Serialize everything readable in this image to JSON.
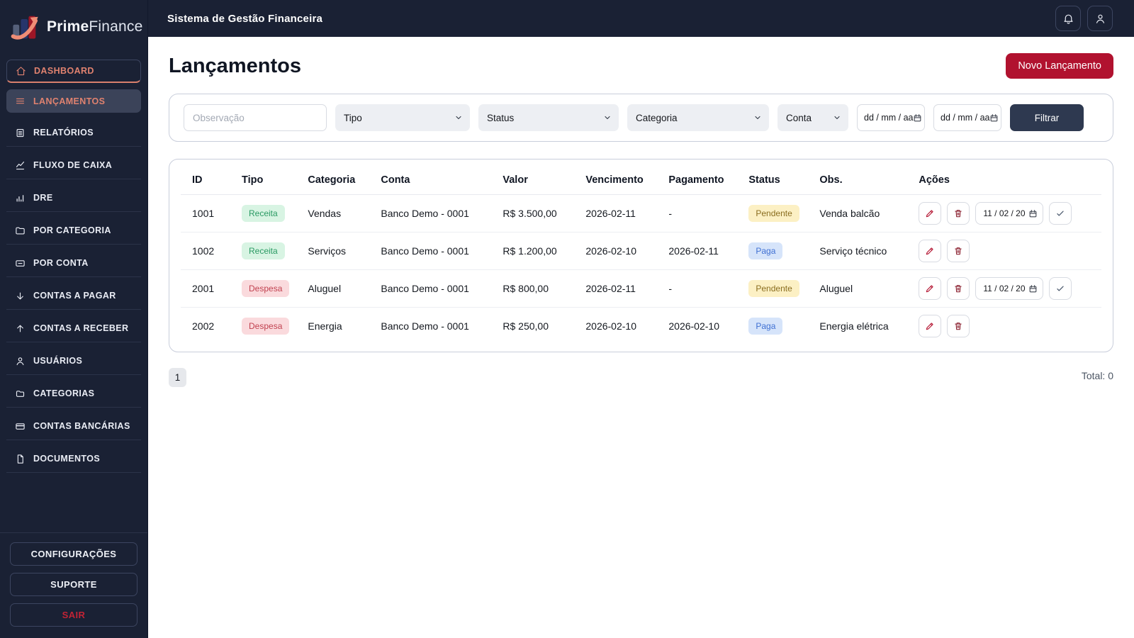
{
  "brand": {
    "name_bold": "Prime",
    "name_light": "Finance"
  },
  "topbar": {
    "title": "Sistema de Gestão Financeira"
  },
  "sidebar": {
    "items": [
      {
        "label": "DASHBOARD",
        "icon": "home-icon"
      },
      {
        "label": "LANÇAMENTOS",
        "icon": "list-icon"
      },
      {
        "label": "RELATÓRIOS",
        "icon": "report-icon"
      },
      {
        "label": "FLUXO DE CAIXA",
        "icon": "trend-icon"
      },
      {
        "label": "DRE",
        "icon": "bar-chart-icon"
      },
      {
        "label": "POR CATEGORIA",
        "icon": "folder-icon"
      },
      {
        "label": "POR CONTA",
        "icon": "card-minus-icon"
      },
      {
        "label": "CONTAS A PAGAR",
        "icon": "arrow-down-icon"
      },
      {
        "label": "CONTAS A RECEBER",
        "icon": "arrow-up-icon"
      },
      {
        "label": "USUÁRIOS",
        "icon": "person-icon"
      },
      {
        "label": "CATEGORIAS",
        "icon": "folder-icon"
      },
      {
        "label": "CONTAS BANCÁRIAS",
        "icon": "bank-card-icon"
      },
      {
        "label": "DOCUMENTOS",
        "icon": "document-icon"
      }
    ],
    "footer": {
      "settings": "CONFIGURAÇÕES",
      "support": "SUPORTE",
      "logout": "SAIR"
    }
  },
  "page": {
    "title": "Lançamentos",
    "new_button": "Novo Lançamento"
  },
  "filters": {
    "observacao_placeholder": "Observação",
    "tipo": "Tipo",
    "status": "Status",
    "categoria": "Categoria",
    "conta": "Conta",
    "date_from": "dd / mm / aa",
    "date_to": "dd / mm / aa",
    "filter_button": "Filtrar"
  },
  "table": {
    "headers": {
      "id": "ID",
      "tipo": "Tipo",
      "categoria": "Categoria",
      "conta": "Conta",
      "valor": "Valor",
      "vencimento": "Vencimento",
      "pagamento": "Pagamento",
      "status": "Status",
      "obs": "Obs.",
      "acoes": "Ações"
    },
    "rows": [
      {
        "id": "1001",
        "tipo": "Receita",
        "categoria": "Vendas",
        "conta": "Banco Demo - 0001",
        "valor": "R$ 3.500,00",
        "vencimento": "2026-02-11",
        "pagamento": "-",
        "status": "Pendente",
        "obs": "Venda balcão",
        "pay_date": "11 / 02 / 20"
      },
      {
        "id": "1002",
        "tipo": "Receita",
        "categoria": "Serviços",
        "conta": "Banco Demo - 0001",
        "valor": "R$ 1.200,00",
        "vencimento": "2026-02-10",
        "pagamento": "2026-02-11",
        "status": "Paga",
        "obs": "Serviço técnico"
      },
      {
        "id": "2001",
        "tipo": "Despesa",
        "categoria": "Aluguel",
        "conta": "Banco Demo - 0001",
        "valor": "R$ 800,00",
        "vencimento": "2026-02-11",
        "pagamento": "-",
        "status": "Pendente",
        "obs": "Aluguel",
        "pay_date": "11 / 02 / 20"
      },
      {
        "id": "2002",
        "tipo": "Despesa",
        "categoria": "Energia",
        "conta": "Banco Demo - 0001",
        "valor": "R$ 250,00",
        "vencimento": "2026-02-10",
        "pagamento": "2026-02-10",
        "status": "Paga",
        "obs": "Energia elétrica"
      }
    ]
  },
  "pagination": {
    "page_1": "1",
    "total_label": "Total: 0"
  },
  "colors": {
    "sidebar_bg": "#1a2134",
    "accent_coral": "#e0826f",
    "primary_red": "#b1122f",
    "filter_btn_navy": "#2e3950",
    "badge_receita_bg": "#d8f4e3",
    "badge_receita_text": "#2a9a63",
    "badge_despesa_bg": "#fadadd",
    "badge_despesa_text": "#c14250",
    "badge_pendente_bg": "#fcf0c4",
    "badge_pendente_text": "#8a6d1f",
    "badge_paga_bg": "#d6e4fa",
    "badge_paga_text": "#3f70d3"
  }
}
